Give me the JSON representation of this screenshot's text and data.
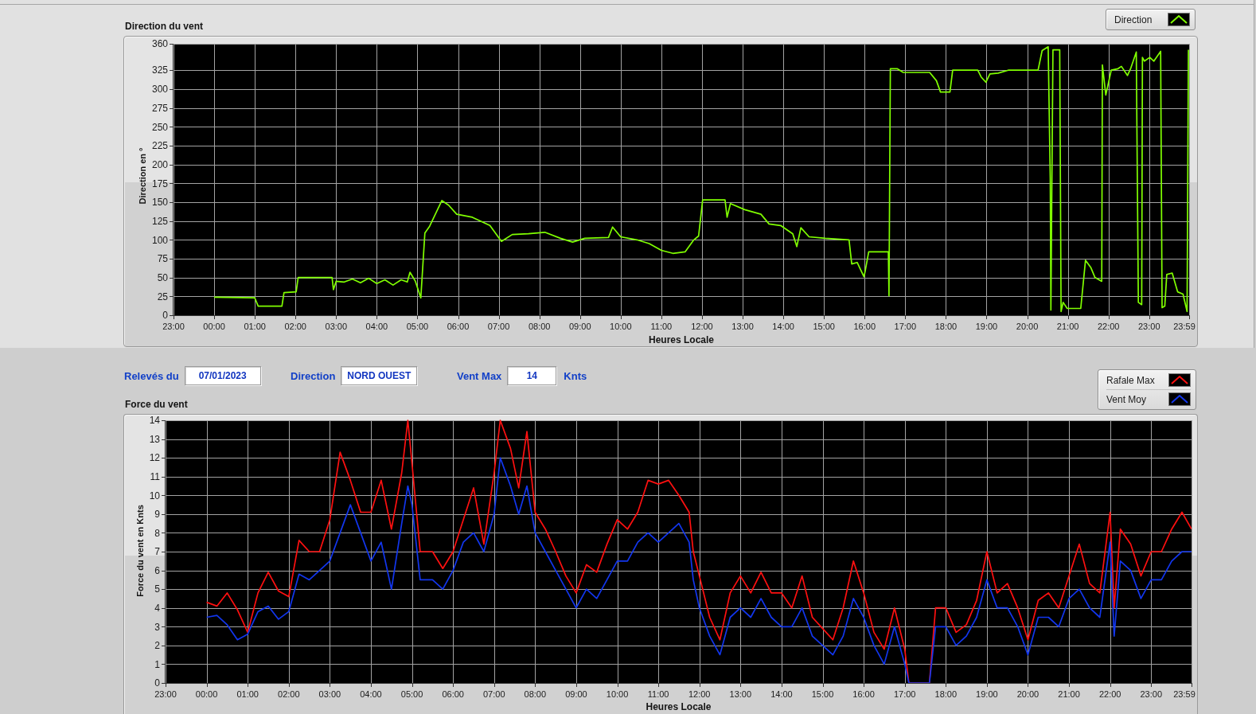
{
  "direction_graph": {
    "chart_data": {
      "type": "line",
      "title": "Direction du vent",
      "xlabel": "Heures Locale",
      "ylabel": "Direction en °",
      "grid": true,
      "x": [
        "2023-01-07T00:00",
        "2023-01-07T01:00",
        "2023-01-07T01:05",
        "2023-01-07T01:40",
        "2023-01-07T01:43",
        "2023-01-07T02:01",
        "2023-01-07T02:04",
        "2023-01-07T02:54",
        "2023-01-07T02:56",
        "2023-01-07T03:00",
        "2023-01-07T03:12",
        "2023-01-07T03:24",
        "2023-01-07T03:36",
        "2023-01-07T03:48",
        "2023-01-07T04:00",
        "2023-01-07T04:12",
        "2023-01-07T04:24",
        "2023-01-07T04:36",
        "2023-01-07T04:45",
        "2023-01-07T04:49",
        "2023-01-07T04:57",
        "2023-01-07T05:05",
        "2023-01-07T05:11",
        "2023-01-07T05:18",
        "2023-01-07T05:36",
        "2023-01-07T05:46",
        "2023-01-07T05:58",
        "2023-01-07T06:21",
        "2023-01-07T06:47",
        "2023-01-07T07:04",
        "2023-01-07T07:20",
        "2023-01-07T07:44",
        "2023-01-07T08:08",
        "2023-01-07T08:31",
        "2023-01-07T08:49",
        "2023-01-07T09:07",
        "2023-01-07T09:42",
        "2023-01-07T09:48",
        "2023-01-07T10:00",
        "2023-01-07T10:24",
        "2023-01-07T10:42",
        "2023-01-07T11:00",
        "2023-01-07T11:17",
        "2023-01-07T11:35",
        "2023-01-07T11:48",
        "2023-01-07T11:55",
        "2023-01-07T12:01",
        "2023-01-07T12:34",
        "2023-01-07T12:37",
        "2023-01-07T12:42",
        "2023-01-07T13:03",
        "2023-01-07T13:27",
        "2023-01-07T13:39",
        "2023-01-07T13:56",
        "2023-01-07T14:14",
        "2023-01-07T14:20",
        "2023-01-07T14:26",
        "2023-01-07T14:38",
        "2023-01-07T15:02",
        "2023-01-07T15:37",
        "2023-01-07T15:41",
        "2023-01-07T15:49",
        "2023-01-07T15:59",
        "2023-01-07T16:01",
        "2023-01-07T16:06",
        "2023-01-07T16:35",
        "2023-01-07T16:36",
        "2023-01-07T16:38",
        "2023-01-07T16:48",
        "2023-01-07T16:57",
        "2023-01-07T17:36",
        "2023-01-07T17:46",
        "2023-01-07T17:52",
        "2023-01-07T18:06",
        "2023-01-07T18:10",
        "2023-01-07T18:47",
        "2023-01-07T18:52",
        "2023-01-07T18:59",
        "2023-01-07T19:05",
        "2023-01-07T19:17",
        "2023-01-07T19:32",
        "2023-01-07T20:16",
        "2023-01-07T20:22",
        "2023-01-07T20:31",
        "2023-01-07T20:34",
        "2023-01-07T20:35",
        "2023-01-07T20:38",
        "2023-01-07T20:48",
        "2023-01-07T20:50",
        "2023-01-07T20:53",
        "2023-01-07T20:59",
        "2023-01-07T21:19",
        "2023-01-07T21:26",
        "2023-01-07T21:34",
        "2023-01-07T21:40",
        "2023-01-07T21:50",
        "2023-01-07T21:51",
        "2023-01-07T21:56",
        "2023-01-07T22:04",
        "2023-01-07T22:14",
        "2023-01-07T22:19",
        "2023-01-07T22:28",
        "2023-01-07T22:33",
        "2023-01-07T22:41",
        "2023-01-07T22:44",
        "2023-01-07T22:49",
        "2023-01-07T22:50",
        "2023-01-07T22:53",
        "2023-01-07T23:01",
        "2023-01-07T23:07",
        "2023-01-07T23:17",
        "2023-01-07T23:19",
        "2023-01-07T23:23",
        "2023-01-07T23:26",
        "2023-01-07T23:34",
        "2023-01-07T23:42",
        "2023-01-07T23:50",
        "2023-01-07T23:56",
        "2023-01-07T23:58"
      ],
      "series": [
        {
          "name": "Direction",
          "color": "#80ff00",
          "values": [
            24,
            23,
            12,
            12,
            30,
            31,
            50,
            50,
            34,
            45,
            44,
            48,
            43,
            49,
            42,
            47,
            40,
            47,
            44,
            57,
            45,
            23,
            109,
            118,
            152,
            146,
            134,
            130,
            119,
            98,
            107,
            108,
            110,
            102,
            97,
            102,
            103,
            117,
            104,
            100,
            95,
            86,
            82,
            84,
            100,
            105,
            153,
            153,
            130,
            148,
            140,
            134,
            121,
            119,
            108,
            91,
            116,
            104,
            102,
            100,
            68,
            70,
            51,
            59,
            84,
            84,
            26,
            327,
            327,
            322,
            322,
            311,
            296,
            296,
            325,
            325,
            316,
            309,
            320,
            321,
            325,
            325,
            351,
            356,
            182,
            7,
            352,
            352,
            5,
            17,
            9,
            9,
            73,
            63,
            50,
            45,
            332,
            292,
            325,
            327,
            330,
            318,
            328,
            349,
            17,
            14,
            342,
            337,
            342,
            337,
            350,
            10,
            12,
            54,
            56,
            31,
            28,
            5,
            352
          ]
        }
      ],
      "xlim": [
        "2023-01-06T23:00",
        "2023-01-07T23:59"
      ],
      "ylim": [
        0,
        360
      ],
      "xticks": [
        {
          "value": "2023-01-06T23:00",
          "label": "23:00"
        },
        {
          "value": "2023-01-07T00:00",
          "label": "00:00"
        },
        {
          "value": "2023-01-07T01:00",
          "label": "01:00"
        },
        {
          "value": "2023-01-07T02:00",
          "label": "02:00"
        },
        {
          "value": "2023-01-07T03:00",
          "label": "03:00"
        },
        {
          "value": "2023-01-07T04:00",
          "label": "04:00"
        },
        {
          "value": "2023-01-07T05:00",
          "label": "05:00"
        },
        {
          "value": "2023-01-07T06:00",
          "label": "06:00"
        },
        {
          "value": "2023-01-07T07:00",
          "label": "07:00"
        },
        {
          "value": "2023-01-07T08:00",
          "label": "08:00"
        },
        {
          "value": "2023-01-07T09:00",
          "label": "09:00"
        },
        {
          "value": "2023-01-07T10:00",
          "label": "10:00"
        },
        {
          "value": "2023-01-07T11:00",
          "label": "11:00"
        },
        {
          "value": "2023-01-07T12:00",
          "label": "12:00"
        },
        {
          "value": "2023-01-07T13:00",
          "label": "13:00"
        },
        {
          "value": "2023-01-07T14:00",
          "label": "14:00"
        },
        {
          "value": "2023-01-07T15:00",
          "label": "15:00"
        },
        {
          "value": "2023-01-07T16:00",
          "label": "16:00"
        },
        {
          "value": "2023-01-07T17:00",
          "label": "17:00"
        },
        {
          "value": "2023-01-07T18:00",
          "label": "18:00"
        },
        {
          "value": "2023-01-07T19:00",
          "label": "19:00"
        },
        {
          "value": "2023-01-07T20:00",
          "label": "20:00"
        },
        {
          "value": "2023-01-07T21:00",
          "label": "21:00"
        },
        {
          "value": "2023-01-07T22:00",
          "label": "22:00"
        },
        {
          "value": "2023-01-07T23:00",
          "label": "23:00"
        },
        {
          "value": "2023-01-07T23:59",
          "label": "23:59"
        }
      ],
      "yticks": [
        0,
        25,
        50,
        75,
        100,
        125,
        150,
        175,
        200,
        225,
        250,
        275,
        300,
        325,
        360
      ]
    }
  },
  "readings": [
    {
      "label": "Relevés du",
      "value": "07/01/2023"
    },
    {
      "label": "Direction",
      "value": "NORD OUEST"
    },
    {
      "label": "Vent Max",
      "value": "14",
      "unit": "Knts"
    }
  ],
  "force_graph": {
    "chart_data": {
      "type": "line",
      "title": "Force du vent",
      "xlabel": "Heures Locale",
      "ylabel": "Force du vent en Knts",
      "grid": true,
      "x": [
        "2023-01-07T00:00",
        "2023-01-07T00:15",
        "2023-01-07T00:30",
        "2023-01-07T00:45",
        "2023-01-07T01:00",
        "2023-01-07T01:15",
        "2023-01-07T01:30",
        "2023-01-07T01:45",
        "2023-01-07T02:00",
        "2023-01-07T02:15",
        "2023-01-07T02:30",
        "2023-01-07T02:45",
        "2023-01-07T03:00",
        "2023-01-07T03:15",
        "2023-01-07T03:30",
        "2023-01-07T03:45",
        "2023-01-07T04:00",
        "2023-01-07T04:15",
        "2023-01-07T04:30",
        "2023-01-07T04:45",
        "2023-01-07T04:54",
        "2023-01-07T05:00",
        "2023-01-07T05:12",
        "2023-01-07T05:30",
        "2023-01-07T05:45",
        "2023-01-07T06:00",
        "2023-01-07T06:15",
        "2023-01-07T06:30",
        "2023-01-07T06:45",
        "2023-01-07T07:00",
        "2023-01-07T07:09",
        "2023-01-07T07:24",
        "2023-01-07T07:36",
        "2023-01-07T07:48",
        "2023-01-07T08:00",
        "2023-01-07T08:15",
        "2023-01-07T08:30",
        "2023-01-07T08:45",
        "2023-01-07T09:00",
        "2023-01-07T09:15",
        "2023-01-07T09:30",
        "2023-01-07T09:45",
        "2023-01-07T10:00",
        "2023-01-07T10:15",
        "2023-01-07T10:30",
        "2023-01-07T10:45",
        "2023-01-07T11:00",
        "2023-01-07T11:15",
        "2023-01-07T11:30",
        "2023-01-07T11:45",
        "2023-01-07T11:51",
        "2023-01-07T12:00",
        "2023-01-07T12:15",
        "2023-01-07T12:30",
        "2023-01-07T12:45",
        "2023-01-07T13:00",
        "2023-01-07T13:15",
        "2023-01-07T13:30",
        "2023-01-07T13:45",
        "2023-01-07T14:00",
        "2023-01-07T14:15",
        "2023-01-07T14:30",
        "2023-01-07T14:45",
        "2023-01-07T15:00",
        "2023-01-07T15:15",
        "2023-01-07T15:30",
        "2023-01-07T15:45",
        "2023-01-07T16:00",
        "2023-01-07T16:15",
        "2023-01-07T16:30",
        "2023-01-07T16:45",
        "2023-01-07T17:00",
        "2023-01-07T17:06",
        "2023-01-07T17:36",
        "2023-01-07T17:45",
        "2023-01-07T18:00",
        "2023-01-07T18:15",
        "2023-01-07T18:30",
        "2023-01-07T18:45",
        "2023-01-07T19:00",
        "2023-01-07T19:15",
        "2023-01-07T19:30",
        "2023-01-07T19:45",
        "2023-01-07T20:00",
        "2023-01-07T20:15",
        "2023-01-07T20:30",
        "2023-01-07T20:45",
        "2023-01-07T21:00",
        "2023-01-07T21:15",
        "2023-01-07T21:30",
        "2023-01-07T21:45",
        "2023-01-07T22:00",
        "2023-01-07T22:06",
        "2023-01-07T22:15",
        "2023-01-07T22:30",
        "2023-01-07T22:45",
        "2023-01-07T23:00",
        "2023-01-07T23:15",
        "2023-01-07T23:30",
        "2023-01-07T23:45",
        "2023-01-07T23:59"
      ],
      "series": [
        {
          "name": "Rafale Max",
          "color": "#ff1010",
          "values": [
            4.3,
            4.1,
            4.8,
            3.9,
            2.7,
            4.8,
            5.9,
            4.9,
            4.6,
            7.6,
            7,
            7,
            8.7,
            12.3,
            10.8,
            9.1,
            9.1,
            10.8,
            8.2,
            11.2,
            14,
            11.7,
            7,
            7,
            6.1,
            7,
            8.7,
            10.4,
            7.4,
            11.2,
            14,
            12.5,
            10.4,
            13.4,
            9.1,
            8.2,
            7,
            5.7,
            4.8,
            6.3,
            5.9,
            7.4,
            8.7,
            8.2,
            9.1,
            10.8,
            10.6,
            10.8,
            10,
            9.1,
            7,
            5.7,
            3.5,
            2.3,
            4.8,
            5.7,
            4.8,
            5.9,
            4.8,
            4.8,
            4,
            5.7,
            3.5,
            2.9,
            2.3,
            4,
            6.5,
            4.8,
            2.7,
            1.8,
            4,
            1.8,
            0,
            0,
            4,
            4,
            2.7,
            3.1,
            4.4,
            7,
            4.8,
            5.3,
            4,
            2.3,
            4.4,
            4.8,
            4,
            5.7,
            7.4,
            5.3,
            4.8,
            9.1,
            4,
            8.2,
            7.4,
            5.7,
            7,
            7,
            8.2,
            9.1,
            8.2
          ]
        },
        {
          "name": "Vent Moy",
          "color": "#1236ee",
          "values": [
            3.5,
            3.6,
            3.1,
            2.3,
            2.6,
            3.8,
            4.1,
            3.4,
            3.8,
            5.8,
            5.5,
            6,
            6.5,
            8,
            9.5,
            8,
            6.5,
            7.5,
            5,
            8.5,
            10.5,
            9.5,
            5.5,
            5.5,
            5,
            6,
            7.5,
            8,
            7,
            9,
            12,
            10.5,
            9,
            10.5,
            8,
            7,
            6,
            5,
            4,
            5,
            4.5,
            5.5,
            6.5,
            6.5,
            7.5,
            8,
            7.5,
            8,
            8.5,
            7.5,
            5.5,
            4,
            2.5,
            1.5,
            3.5,
            4,
            3.5,
            4.5,
            3.5,
            3,
            3,
            4,
            2.5,
            2,
            1.5,
            2.5,
            4.5,
            3.5,
            2,
            1,
            3,
            1,
            0,
            0,
            3,
            3,
            2,
            2.5,
            3.5,
            5.5,
            4,
            4,
            3,
            1.5,
            3.5,
            3.5,
            3,
            4.5,
            5,
            4,
            3.5,
            7.5,
            2.5,
            6.5,
            6,
            4.5,
            5.5,
            5.5,
            6.5,
            7,
            7
          ]
        }
      ],
      "xlim": [
        "2023-01-06T23:00",
        "2023-01-07T23:59"
      ],
      "ylim": [
        0,
        14
      ],
      "xticks": [
        {
          "value": "2023-01-06T23:00",
          "label": "23:00"
        },
        {
          "value": "2023-01-07T00:00",
          "label": "00:00"
        },
        {
          "value": "2023-01-07T01:00",
          "label": "01:00"
        },
        {
          "value": "2023-01-07T02:00",
          "label": "02:00"
        },
        {
          "value": "2023-01-07T03:00",
          "label": "03:00"
        },
        {
          "value": "2023-01-07T04:00",
          "label": "04:00"
        },
        {
          "value": "2023-01-07T05:00",
          "label": "05:00"
        },
        {
          "value": "2023-01-07T06:00",
          "label": "06:00"
        },
        {
          "value": "2023-01-07T07:00",
          "label": "07:00"
        },
        {
          "value": "2023-01-07T08:00",
          "label": "08:00"
        },
        {
          "value": "2023-01-07T09:00",
          "label": "09:00"
        },
        {
          "value": "2023-01-07T10:00",
          "label": "10:00"
        },
        {
          "value": "2023-01-07T11:00",
          "label": "11:00"
        },
        {
          "value": "2023-01-07T12:00",
          "label": "12:00"
        },
        {
          "value": "2023-01-07T13:00",
          "label": "13:00"
        },
        {
          "value": "2023-01-07T14:00",
          "label": "14:00"
        },
        {
          "value": "2023-01-07T15:00",
          "label": "15:00"
        },
        {
          "value": "2023-01-07T16:00",
          "label": "16:00"
        },
        {
          "value": "2023-01-07T17:00",
          "label": "17:00"
        },
        {
          "value": "2023-01-07T18:00",
          "label": "18:00"
        },
        {
          "value": "2023-01-07T19:00",
          "label": "19:00"
        },
        {
          "value": "2023-01-07T20:00",
          "label": "20:00"
        },
        {
          "value": "2023-01-07T21:00",
          "label": "21:00"
        },
        {
          "value": "2023-01-07T22:00",
          "label": "22:00"
        },
        {
          "value": "2023-01-07T23:00",
          "label": "23:00"
        },
        {
          "value": "2023-01-07T23:59",
          "label": "23:59"
        }
      ],
      "yticks": [
        0,
        1,
        2,
        3,
        4,
        5,
        6,
        7,
        8,
        9,
        10,
        11,
        12,
        13,
        14
      ]
    }
  }
}
